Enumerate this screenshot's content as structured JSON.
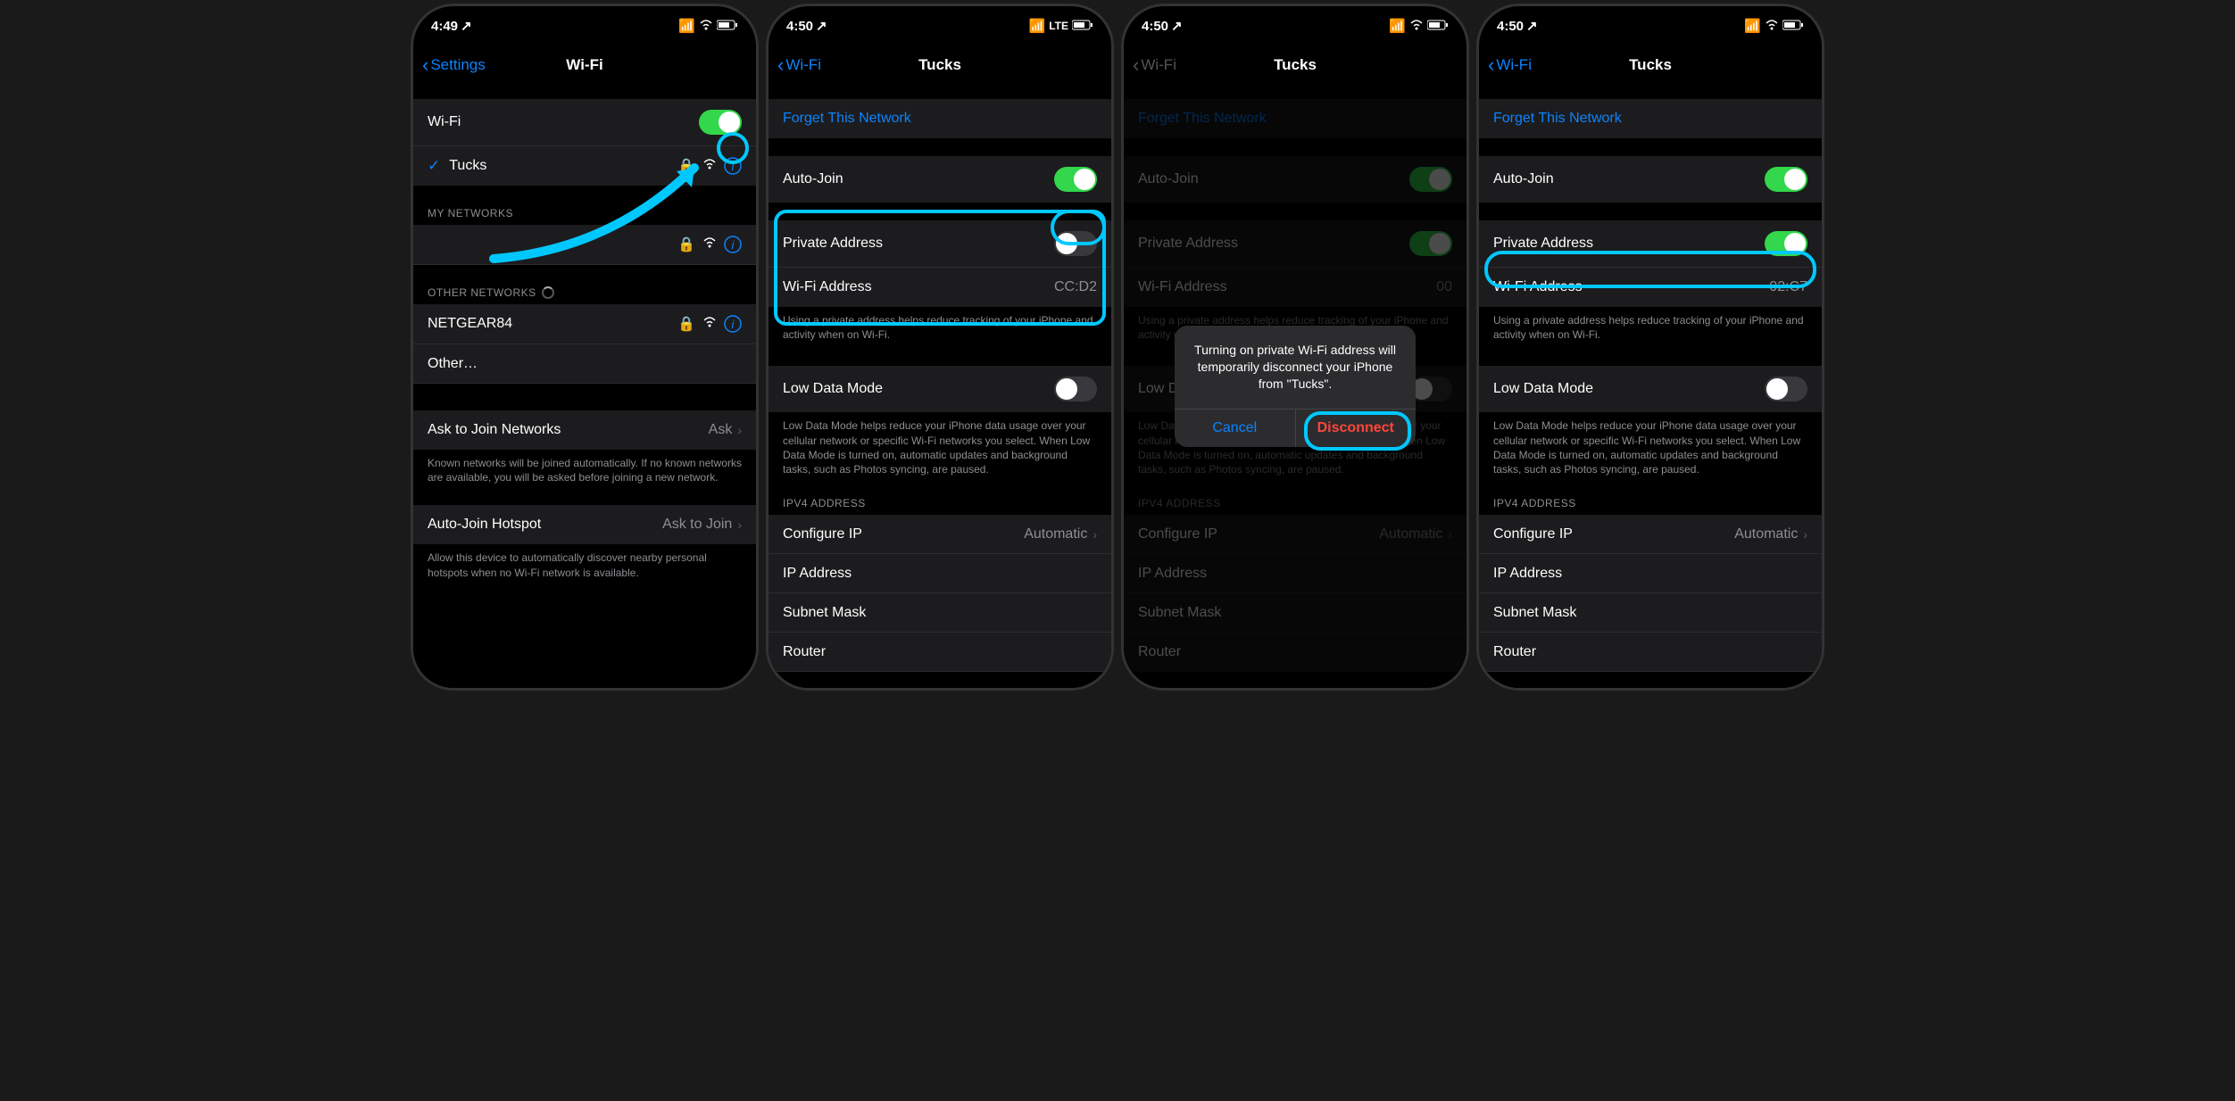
{
  "screen1": {
    "time": "4:49",
    "back": "Settings",
    "title": "Wi-Fi",
    "wifi_label": "Wi-Fi",
    "connected": "Tucks",
    "my_networks": "MY NETWORKS",
    "other_networks": "OTHER NETWORKS",
    "netgear": "NETGEAR84",
    "other": "Other…",
    "ask_join": "Ask to Join Networks",
    "ask_value": "Ask",
    "ask_footer": "Known networks will be joined automatically. If no known networks are available, you will be asked before joining a new network.",
    "hotspot": "Auto-Join Hotspot",
    "hotspot_value": "Ask to Join",
    "hotspot_footer": "Allow this device to automatically discover nearby personal hotspots when no Wi-Fi network is available."
  },
  "detail": {
    "back": "Wi-Fi",
    "title": "Tucks",
    "forget": "Forget This Network",
    "autojoin": "Auto-Join",
    "private_addr": "Private Address",
    "wifi_addr": "Wi-Fi Address",
    "addr_footer": "Using a private address helps reduce tracking of your iPhone and activity when on Wi-Fi.",
    "low_data": "Low Data Mode",
    "low_data_footer": "Low Data Mode helps reduce your iPhone data usage over your cellular network or specific Wi-Fi networks you select. When Low Data Mode is turned on, automatic updates and background tasks, such as Photos syncing, are paused.",
    "ipv4": "IPV4 ADDRESS",
    "configure": "Configure IP",
    "configure_val": "Automatic",
    "ip": "IP Address",
    "subnet": "Subnet Mask",
    "router": "Router"
  },
  "screen2": {
    "time": "4:50",
    "mac": "CC:D2",
    "signal": "LTE"
  },
  "screen3": {
    "time": "4:50",
    "mac": "00",
    "modal": "Turning on private Wi-Fi address will temporarily disconnect your iPhone from \"Tucks\".",
    "cancel": "Cancel",
    "disconnect": "Disconnect"
  },
  "screen4": {
    "time": "4:50",
    "mac": "02:C7"
  }
}
